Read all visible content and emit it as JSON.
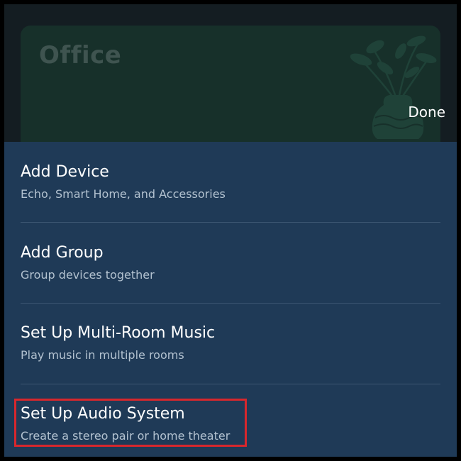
{
  "room_card": {
    "title": "Office",
    "illustration": "plant-in-vase-icon"
  },
  "header": {
    "done_label": "Done"
  },
  "menu": {
    "items": [
      {
        "title": "Add Device",
        "subtitle": "Echo, Smart Home, and Accessories"
      },
      {
        "title": "Add Group",
        "subtitle": "Group devices together"
      },
      {
        "title": "Set Up Multi-Room Music",
        "subtitle": "Play music in multiple rooms"
      },
      {
        "title": "Set Up Audio System",
        "subtitle": "Create a stereo pair or home theater"
      }
    ]
  },
  "colors": {
    "sheet_background": "#1f3a57",
    "card_background": "#17302a",
    "highlight_border": "#d8272d",
    "text_primary": "#ffffff",
    "text_secondary": "#b3c2d0"
  }
}
